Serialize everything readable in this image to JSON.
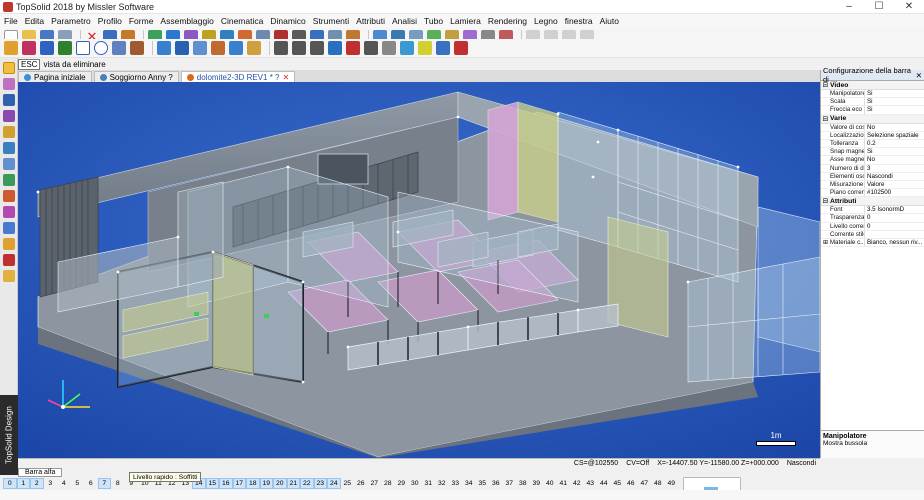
{
  "window": {
    "title": "TopSolid 2018 by Missler Software",
    "min": "–",
    "max": "☐",
    "close": "✕"
  },
  "menu": [
    "File",
    "Edita",
    "Parametro",
    "Profilo",
    "Forme",
    "Assemblaggio",
    "Cinematica",
    "Dinamico",
    "Strumenti",
    "Attributi",
    "Analisi",
    "Tubo",
    "Lamiera",
    "Rendering",
    "Legno",
    "finestra",
    "Aiuto"
  ],
  "esc": {
    "key": "ESC",
    "label": "vista da eliminare"
  },
  "tabs": [
    {
      "label": "Pagina iniziale",
      "active": false,
      "dot": "#3a8fd8"
    },
    {
      "label": "Soggiorno Anny ?",
      "active": false,
      "dot": "#4a7fb8"
    },
    {
      "label": "dolomite2-3D REV1 * ?",
      "active": true,
      "dot": "#d66a1a"
    }
  ],
  "brand": "TopSolid Design",
  "panel": {
    "title": "Configurazione della barra di ...",
    "close": "✕",
    "sections": [
      {
        "title": "Video",
        "rows": [
          {
            "k": "Manipolatore",
            "v": "Si"
          },
          {
            "k": "Scala",
            "v": "Si"
          },
          {
            "k": "Freccia eco",
            "v": "Si"
          }
        ]
      },
      {
        "title": "Varie",
        "rows": [
          {
            "k": "Valore di costr...",
            "v": "No"
          },
          {
            "k": "Localizzazione",
            "v": "Selezione spaziale"
          },
          {
            "k": "Tolleranza",
            "v": "0.2"
          },
          {
            "k": "Snap magnetico",
            "v": "Si"
          },
          {
            "k": "Asse magnetico",
            "v": "No"
          },
          {
            "k": "Numero di deci...",
            "v": "3"
          },
          {
            "k": "Elementi oscurati",
            "v": "Nascondi"
          },
          {
            "k": "Misurazione",
            "v": "Valore"
          },
          {
            "k": "Piano corrente",
            "v": "#102500"
          }
        ]
      },
      {
        "title": "Attributi",
        "rows": [
          {
            "k": "Font",
            "v": "3.5  IsonormD"
          },
          {
            "k": "Trasparenza",
            "v": "0"
          },
          {
            "k": "Livello corrente",
            "v": "0"
          },
          {
            "k": "Corrente stile d...",
            "v": ""
          },
          {
            "k": "⊞  Materiale c...",
            "v": "Bianco, nessun riv..."
          }
        ]
      }
    ],
    "footer_title": "Manipolatore",
    "footer_text": "Mostra bussola"
  },
  "status": {
    "cs": "CS=@102550",
    "cv": "CV=Off",
    "coords": "X=-14407.50   Y=-11580.00   Z=+000.000",
    "mode": "Nascondi"
  },
  "scale_label": "1m",
  "layer_tab": "Barra alfa",
  "tooltip": "Livello rapido : Soffitti",
  "levels": [
    "0",
    "1",
    "2",
    "3",
    "4",
    "5",
    "6",
    "7",
    "8",
    "9",
    "10",
    "11",
    "12",
    "13",
    "14",
    "15",
    "16",
    "17",
    "18",
    "19",
    "20",
    "21",
    "22",
    "23",
    "24",
    "25",
    "26",
    "27",
    "28",
    "29",
    "30",
    "31",
    "32",
    "33",
    "34",
    "35",
    "36",
    "37",
    "38",
    "39",
    "40",
    "41",
    "42",
    "43",
    "44",
    "45",
    "46",
    "47",
    "48",
    "49"
  ],
  "levels_on": [
    "0",
    "1",
    "2",
    "7",
    "14",
    "15",
    "16",
    "17",
    "18",
    "19",
    "20",
    "21",
    "22",
    "23",
    "24"
  ],
  "colors": {
    "viewport_bg": "#2a5bbf",
    "accent": "#2252a8",
    "glass": "#b8d4e8",
    "pink": "#d8a6d8",
    "yellow": "#d8d88a"
  }
}
